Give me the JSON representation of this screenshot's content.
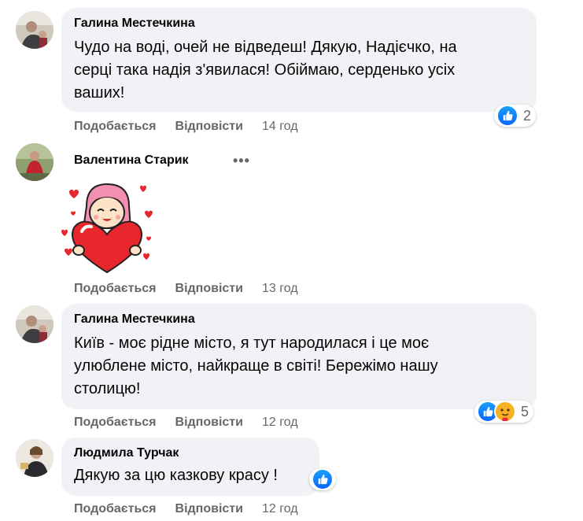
{
  "comments": [
    {
      "author": "Галина Местечкина",
      "lines": [
        "Чудо на воді, очей не відведеш! Дякую, Надієчко, на",
        "серці така надія з'явилася! Обіймаю, серденько усіх",
        "ваших!"
      ],
      "like_label": "Подобається",
      "reply_label": "Відповісти",
      "time": "14 год",
      "reactions": {
        "count": "2",
        "icons": [
          "like-icon"
        ]
      }
    },
    {
      "author": "Валентина Старик",
      "more_label": "•••",
      "sticker": "girl-with-heart-sticker",
      "like_label": "Подобається",
      "reply_label": "Відповісти",
      "time": "13 год"
    },
    {
      "author": "Галина Местечкина",
      "lines": [
        "Київ - моє рідне місто, я тут народилася і це моє",
        "улюблене місто, найкраще в світі! Бережімо нашу",
        "столицю!"
      ],
      "like_label": "Подобається",
      "reply_label": "Відповісти",
      "time": "12 год",
      "reactions": {
        "count": "5",
        "icons": [
          "like-icon",
          "care-icon"
        ]
      }
    },
    {
      "author": "Людмила Турчак",
      "lines": [
        "Дякую за цю казкову красу !"
      ],
      "like_label": "Подобається",
      "reply_label": "Відповісти",
      "time": "12 год",
      "reactions": {
        "icons": [
          "like-icon"
        ]
      }
    }
  ],
  "colors": {
    "bubble": "#f0f2f5",
    "meta": "#65676b",
    "like": "#0866ff"
  }
}
